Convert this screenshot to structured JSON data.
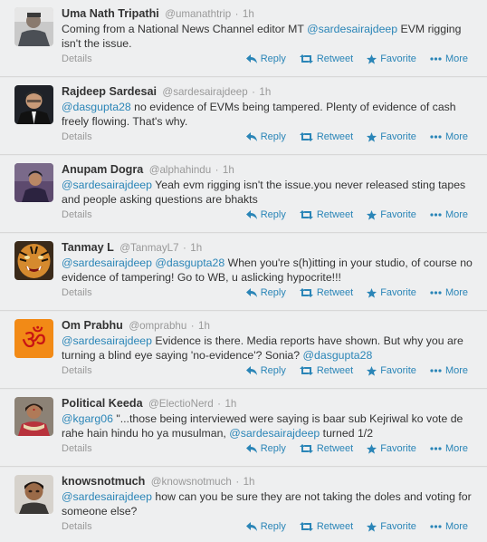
{
  "actions": {
    "reply": "Reply",
    "retweet": "Retweet",
    "favorite": "Favorite",
    "more": "More",
    "details": "Details"
  },
  "colors": {
    "link": "#2a85b7",
    "background": "#eeeff0"
  },
  "tweets": [
    {
      "fullname": "Uma Nath Tripathi",
      "username": "@umanathtrip",
      "time": "1h",
      "avatar": "avatar-person-grey-jacket",
      "parts": [
        {
          "t": "Coming from a National News Channel editor MT ",
          "m": false
        },
        {
          "t": "@sardesairajdeep",
          "m": true
        },
        {
          "t": " EVM rigging isn't the issue.",
          "m": false
        }
      ]
    },
    {
      "fullname": "Rajdeep Sardesai",
      "username": "@sardesairajdeep",
      "time": "1h",
      "avatar": "avatar-man-dark-suit",
      "parts": [
        {
          "t": "@dasgupta28",
          "m": true
        },
        {
          "t": " no evidence of  EVMs being tampered. Plenty of evidence of cash freely flowing. That's why.",
          "m": false
        }
      ]
    },
    {
      "fullname": "Anupam Dogra",
      "username": "@alphahindu",
      "time": "1h",
      "avatar": "avatar-person-purple",
      "parts": [
        {
          "t": "@sardesairajdeep",
          "m": true
        },
        {
          "t": " Yeah evm rigging isn't the issue.you never released sting tapes and people asking questions are bhakts",
          "m": false
        }
      ]
    },
    {
      "fullname": "Tanmay L",
      "username": "@TanmayL7",
      "time": "1h",
      "avatar": "avatar-tiger",
      "parts": [
        {
          "t": "@sardesairajdeep",
          "m": true
        },
        {
          "t": " ",
          "m": false
        },
        {
          "t": "@dasgupta28",
          "m": true
        },
        {
          "t": " When you're s(h)itting in your studio, of course no evidence of tampering! Go to WB, u aslicking hypocrite!!!",
          "m": false
        }
      ]
    },
    {
      "fullname": "Om Prabhu",
      "username": "@omprabhu",
      "time": "1h",
      "avatar": "avatar-om-symbol",
      "parts": [
        {
          "t": "@sardesairajdeep",
          "m": true
        },
        {
          "t": " Evidence is there. Media reports have shown. But why you are turning a blind eye saying 'no-evidence'? Sonia?  ",
          "m": false
        },
        {
          "t": "@dasgupta28",
          "m": true
        }
      ]
    },
    {
      "fullname": "Political Keeda",
      "username": "@ElectioNerd",
      "time": "1h",
      "avatar": "avatar-woman-red",
      "parts": [
        {
          "t": "@kgarg06",
          "m": true
        },
        {
          "t": " \"...those being interviewed were saying is baar sub Kejriwal ko vote de rahe hain hindu ho ya musulman, ",
          "m": false
        },
        {
          "t": "@sardesairajdeep",
          "m": true
        },
        {
          "t": " turned 1/2",
          "m": false
        }
      ]
    },
    {
      "fullname": "knowsnotmuch",
      "username": "@knowsnotmuch",
      "time": "1h",
      "avatar": "avatar-man-portrait",
      "parts": [
        {
          "t": "@sardesairajdeep",
          "m": true
        },
        {
          "t": " how can you be sure they are not taking the doles and voting for someone else?",
          "m": false
        }
      ]
    }
  ]
}
